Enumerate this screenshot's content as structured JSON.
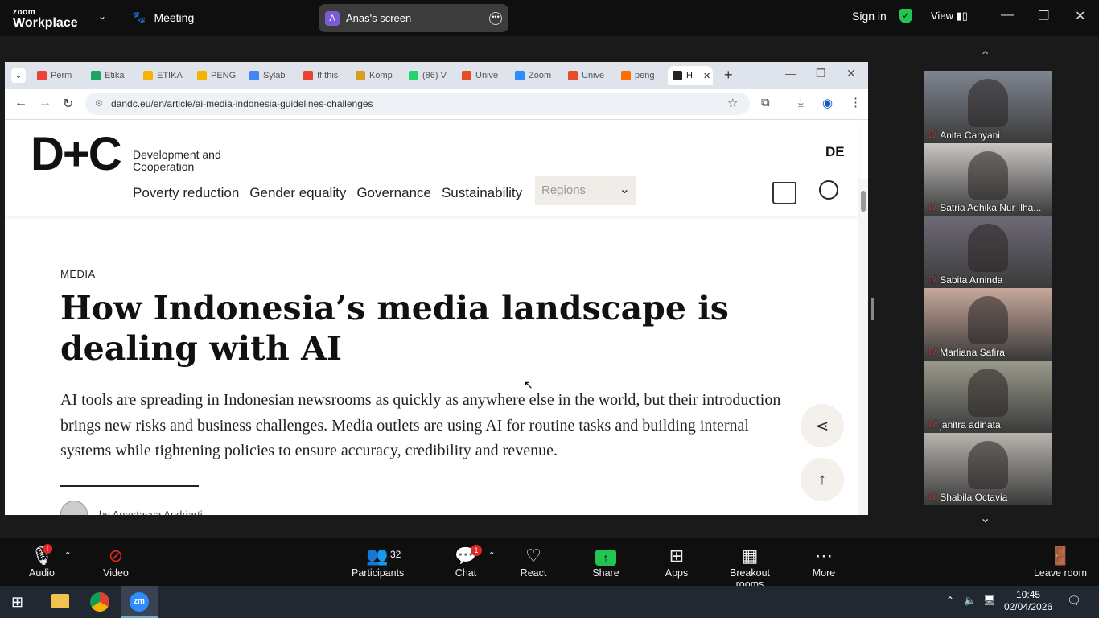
{
  "zoom": {
    "logo_top": "zoom",
    "logo_bottom": "Workplace",
    "meeting_label": "Meeting",
    "share_initial": "A",
    "share_label": "Anas's screen",
    "sign_in": "Sign in",
    "view_label": "View"
  },
  "browser": {
    "tabs": [
      {
        "label": "Perm",
        "color": "#ea4335"
      },
      {
        "label": "Etika",
        "color": "#1fa463"
      },
      {
        "label": "ETIKA",
        "color": "#f4b400"
      },
      {
        "label": "PENG",
        "color": "#f4b400"
      },
      {
        "label": "Sylab",
        "color": "#4285f4"
      },
      {
        "label": "If this",
        "color": "#ea4335"
      },
      {
        "label": "Komp",
        "color": "#d4a017"
      },
      {
        "label": "(86) V",
        "color": "#25d366"
      },
      {
        "label": "Unive",
        "color": "#e44d26"
      },
      {
        "label": "Zoom",
        "color": "#2d8cff"
      },
      {
        "label": "Unive",
        "color": "#e44d26"
      },
      {
        "label": "peng",
        "color": "#ff6f00"
      },
      {
        "label": "H",
        "color": "#222222"
      }
    ],
    "url": "dandc.eu/en/article/ai-media-indonesia-guidelines-challenges"
  },
  "site": {
    "logo": "D+C",
    "logo_sub1": "Development and",
    "logo_sub2": "Cooperation",
    "lang": "DE",
    "nav": [
      "Poverty reduction",
      "Gender equality",
      "Governance",
      "Sustainability"
    ],
    "regions": "Regions",
    "kicker": "MEDIA",
    "title": "How Indonesia’s media landscape is dealing with AI",
    "lead": "AI tools are spreading in Indonesian newsrooms as quickly as anywhere else in the world, but their introduction brings new risks and business challenges. Media outlets are using AI for routine tasks and building internal systems while tightening policies to ensure accuracy, credibility and revenue.",
    "byline": "by Anastasya Andriarti"
  },
  "participants": [
    {
      "name": "Anita Cahyani",
      "bg": "#7f8590"
    },
    {
      "name": "Satria Adhika Nur Ilha...",
      "bg": "#c9c6c4"
    },
    {
      "name": "Sabita Arninda",
      "bg": "#6f6a78"
    },
    {
      "name": "Marliana Safira",
      "bg": "#c7a89a"
    },
    {
      "name": "janitra adinata",
      "bg": "#9a9a8c"
    },
    {
      "name": "Shabila Octavia",
      "bg": "#b8b3ad"
    }
  ],
  "bottombar": {
    "audio": "Audio",
    "audio_badge": "!",
    "video": "Video",
    "participants": "Participants",
    "participants_count": "32",
    "chat": "Chat",
    "chat_badge": "1",
    "react": "React",
    "share": "Share",
    "apps": "Apps",
    "breakout": "Breakout rooms",
    "more": "More",
    "leave": "Leave room"
  },
  "taskbar": {
    "time": "10:45",
    "date": "02/04/2026"
  }
}
